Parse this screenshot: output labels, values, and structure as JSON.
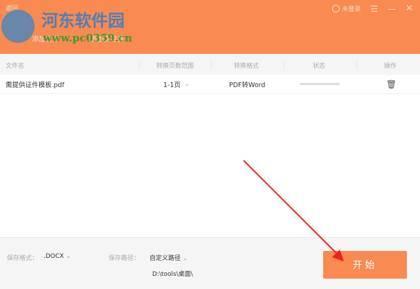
{
  "header": {
    "back": "返回",
    "add_file": "添加文件",
    "add_folder": "添加文件夹",
    "user": "未登录"
  },
  "watermark": {
    "name": "河东软件园",
    "url": "www.pc0359.cn"
  },
  "table": {
    "columns": [
      "文件名",
      "转换页数范围",
      "转换格式",
      "状态",
      "操作"
    ],
    "rows": [
      {
        "name": "需提供证件模板.pdf",
        "range": "1-1页",
        "format": "PDF转Word",
        "progress": 0
      }
    ]
  },
  "footer": {
    "format_label": "保存格式：",
    "format_value": ".DOCX",
    "path_label": "保存路径：",
    "path_mode": "自定义路径",
    "path_value": "D:\\tools\\桌面\\"
  },
  "start_button": "开始",
  "colors": {
    "accent": "#f88a52"
  }
}
